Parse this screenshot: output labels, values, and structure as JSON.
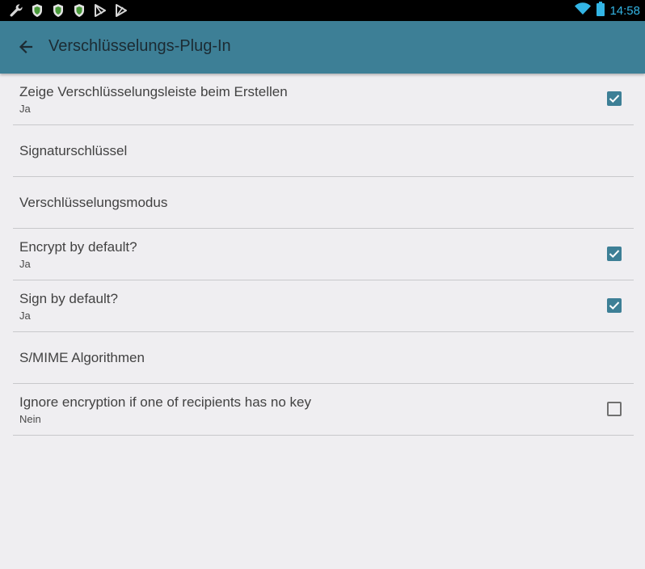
{
  "status_bar": {
    "left_icons": [
      "wrench-icon",
      "shield-icon",
      "shield-icon",
      "shield-icon",
      "play-store-icon",
      "play-store-icon"
    ],
    "clock": "14:58",
    "clock_color": "#33b5e5"
  },
  "app_bar": {
    "title": "Verschlüsselungs-Plug-In",
    "color": "#3d7f96"
  },
  "preferences": [
    {
      "title": "Zeige Verschlüsselungsleiste beim Erstellen",
      "summary": "Ja",
      "checked": true
    },
    {
      "title": "Signaturschlüssel"
    },
    {
      "title": "Verschlüsselungsmodus"
    },
    {
      "title": "Encrypt by default?",
      "summary": "Ja",
      "checked": true
    },
    {
      "title": "Sign by default?",
      "summary": "Ja",
      "checked": true
    },
    {
      "title": "S/MIME Algorithmen"
    },
    {
      "title": "Ignore encryption if one of recipients has no key",
      "summary": "Nein",
      "checked": false
    }
  ]
}
